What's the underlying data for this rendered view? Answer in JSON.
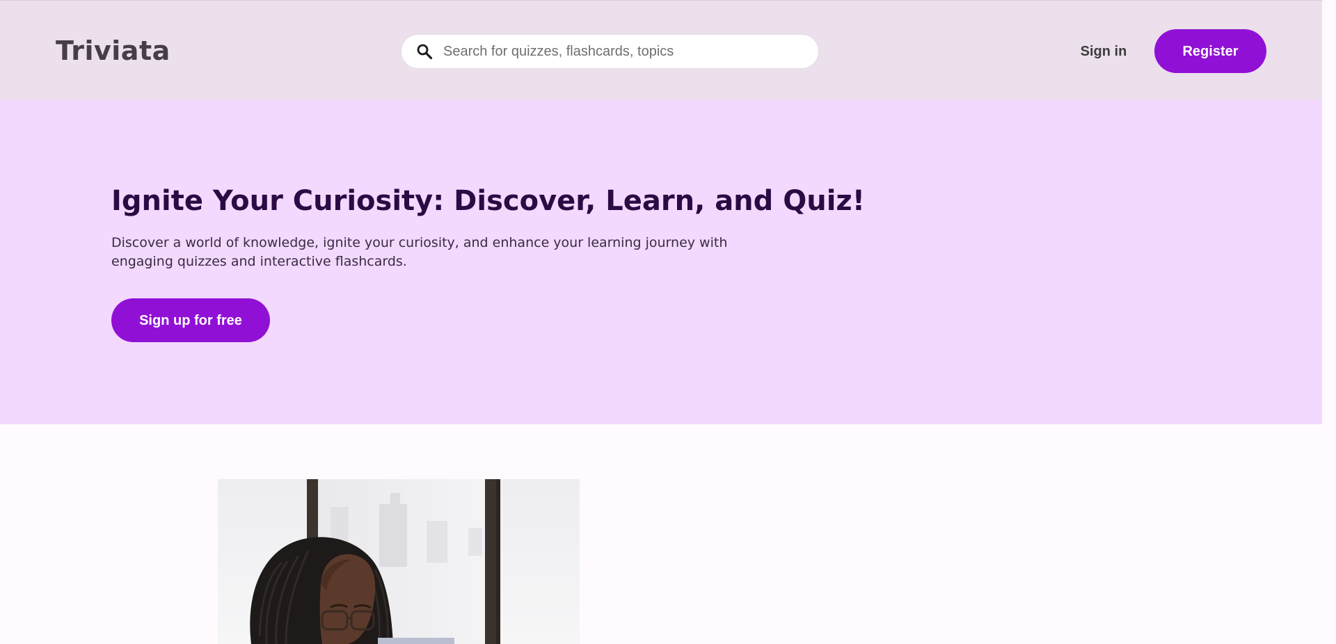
{
  "header": {
    "logo": "Triviata",
    "search": {
      "placeholder": "Search for quizzes, flashcards, topics",
      "value": ""
    },
    "sign_in_label": "Sign in",
    "register_label": "Register"
  },
  "hero": {
    "title": "Ignite Your Curiosity: Discover, Learn, and Quiz!",
    "subtitle": "Discover a world of knowledge, ignite your curiosity, and enhance your learning journey with engaging quizzes and interactive flashcards.",
    "cta_label": "Sign up for free"
  },
  "content": {
    "photo_subject": "woman-with-braids-and-glasses"
  },
  "colors": {
    "header_bg": "#ebe0ec",
    "hero_bg": "#f2d9fd",
    "accent": "#9110d6",
    "title_color": "#2c0a44",
    "page_bg": "#fffafd"
  },
  "icons": {
    "search": "search-icon",
    "scroll_up": "chevron-up-icon",
    "scroll_down": "chevron-down-icon"
  }
}
